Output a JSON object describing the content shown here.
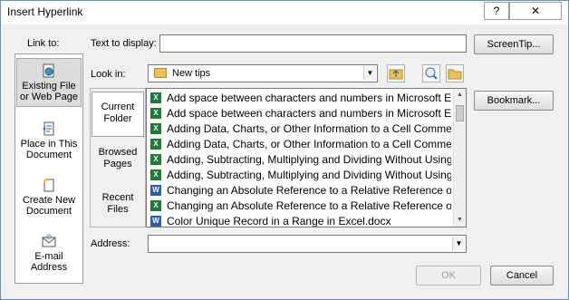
{
  "window": {
    "title": "Insert Hyperlink",
    "help_label": "?",
    "close_label": "✕"
  },
  "linkto": {
    "label": "Link to:",
    "items": [
      {
        "line1": "Existing File",
        "line2": "or Web Page",
        "icon": "globe-file-icon"
      },
      {
        "line1": "Place in This",
        "line2": "Document",
        "icon": "document-place-icon"
      },
      {
        "line1": "Create New",
        "line2": "Document",
        "icon": "new-document-icon"
      },
      {
        "line1": "E-mail",
        "line2": "Address",
        "icon": "email-icon"
      }
    ]
  },
  "text_to_display": {
    "label": "Text to display:",
    "value": ""
  },
  "screentip_label": "ScreenTip...",
  "look_in": {
    "label": "Look in:",
    "value": "New tips"
  },
  "bookmark_label": "Bookmark...",
  "nav": [
    {
      "line1": "Current",
      "line2": "Folder"
    },
    {
      "line1": "Browsed",
      "line2": "Pages"
    },
    {
      "line1": "Recent",
      "line2": "Files"
    }
  ],
  "files": [
    {
      "type": "x",
      "name": "Add space between characters and numbers in Microsoft Excel"
    },
    {
      "type": "x",
      "name": "Add space between characters and numbers in Microsoft Excel"
    },
    {
      "type": "x",
      "name": "Adding Data, Charts, or Other Information to a Cell Comment"
    },
    {
      "type": "x",
      "name": "Adding Data, Charts, or Other Information to a Cell Comment"
    },
    {
      "type": "x",
      "name": "Adding, Subtracting, Multiplying and Dividing Without Using Formulas"
    },
    {
      "type": "x",
      "name": "Adding, Subtracting, Multiplying and Dividing Without Using Formulas"
    },
    {
      "type": "w",
      "name": "Changing an Absolute Reference to a Relative Reference or Vice Versa"
    },
    {
      "type": "x",
      "name": "Changing an Absolute Reference to a Relative Reference or Vice Versa"
    },
    {
      "type": "w",
      "name": "Color Unique Record in a Range in Excel.docx"
    }
  ],
  "address": {
    "label": "Address:",
    "value": ""
  },
  "ok_label": "OK",
  "cancel_label": "Cancel"
}
